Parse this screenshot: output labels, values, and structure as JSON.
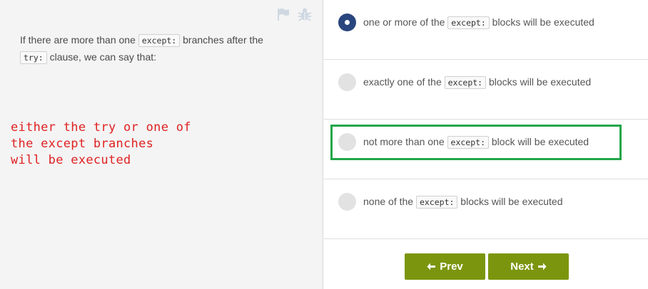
{
  "question": {
    "text_before": "If there are more than one ",
    "code1": "except:",
    "text_middle": " branches after the ",
    "code2": "try:",
    "text_after": " clause, we can say that:"
  },
  "note": {
    "line1": "either the try or one of",
    "line2": "the except branches",
    "line3": "will be executed",
    "color": "#e02121"
  },
  "icons": {
    "flag": "flag-icon",
    "bug": "bug-icon"
  },
  "options": [
    {
      "before": "one or more of the ",
      "code": "except:",
      "after": " blocks will be executed",
      "selected": true
    },
    {
      "before": "exactly one of the ",
      "code": "except:",
      "after": " blocks will be executed",
      "selected": false
    },
    {
      "before": "not more than one ",
      "code": "except:",
      "after": " block will be executed",
      "selected": false
    },
    {
      "before": "none of the ",
      "code": "except:",
      "after": " blocks will be executed",
      "selected": false
    }
  ],
  "highlight_color": "#22a64a",
  "nav": {
    "prev_label": "Prev",
    "next_label": "Next"
  },
  "colors": {
    "accent_button": "#7b960e",
    "radio_selected": "#29457d"
  }
}
